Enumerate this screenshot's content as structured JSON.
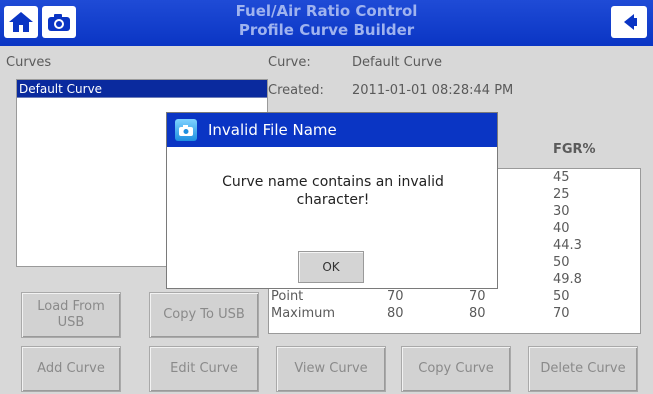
{
  "header": {
    "title_line1": "Fuel/Air Ratio Control",
    "title_line2": "Profile Curve Builder",
    "home_icon": "home-icon",
    "camera_icon": "camera-icon",
    "back_icon": "back-arrow-icon"
  },
  "curves_panel": {
    "label": "Curves",
    "items": [
      "Default Curve"
    ]
  },
  "info": {
    "curve_label": "Curve:",
    "curve_value": "Default Curve",
    "created_label": "Created:",
    "created_value": "2011-01-01 08:28:44 PM"
  },
  "table": {
    "visible_header_fragment": "!%",
    "fgr_header": "FGR%",
    "fgr_values": [
      "45",
      "25",
      "30",
      "40",
      "44.3",
      "50",
      "49.8",
      "50",
      "70"
    ],
    "point_row": {
      "label": "Point",
      "v1": "70",
      "v2": "70"
    },
    "max_row": {
      "label": "Maximum",
      "v1": "80",
      "v2": "80"
    }
  },
  "buttons": {
    "load_usb": "Load From USB",
    "copy_usb": "Copy To USB",
    "add_curve": "Add Curve",
    "edit_curve": "Edit Curve",
    "view_curve": "View Curve",
    "copy_curve": "Copy Curve",
    "delete_curve": "Delete Curve"
  },
  "dialog": {
    "title": "Invalid File Name",
    "message": "Curve name contains an invalid character!",
    "ok_label": "OK"
  },
  "colors": {
    "header_blue": "#0a35c4",
    "title_text": "#9fb3ef",
    "selection": "#0a2a9e"
  }
}
